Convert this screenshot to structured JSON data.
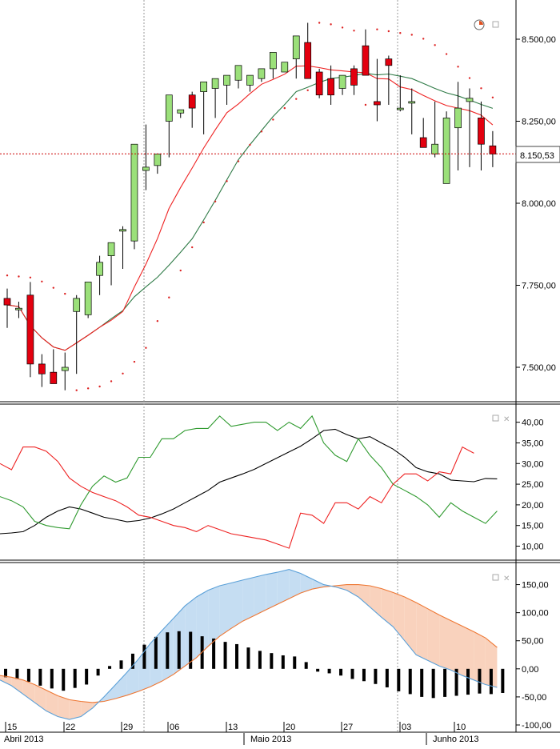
{
  "price_badge": "8.150,53",
  "axis_dates": {
    "ticks": [
      "15",
      "22",
      "29",
      "06",
      "13",
      "20",
      "27",
      "03",
      "10"
    ],
    "months": [
      "Abril 2013",
      "Maio 2013",
      "Junho 2013"
    ]
  },
  "panel_icons": {
    "clock": "clock-icon",
    "restore": "window-restore-icon",
    "close": "close-icon"
  },
  "colors": {
    "up": "#9be07a",
    "down": "#e3000f",
    "ma_fast": "#ee2222",
    "ma_slow": "#2e7a46",
    "psar": "#dd2222",
    "adx": "#000000",
    "di_plus": "#2f9a2f",
    "di_minus": "#ee2222",
    "macd": "#5aa0d8",
    "signal": "#ee7733"
  },
  "chart_data": [
    {
      "type": "candlestick",
      "title": "",
      "ylim": [
        7400,
        8600
      ],
      "yticks": [
        "7.500,00",
        "7.750,00",
        "8.000,00",
        "8.250,00",
        "8.500,00"
      ],
      "ytick_values": [
        7500,
        7750,
        8000,
        8250,
        8500
      ],
      "last_price": 8150.53,
      "x": [
        "Apr 15",
        "Apr 16",
        "Apr 17",
        "Apr 18",
        "Apr 19",
        "Apr 22",
        "Apr 23",
        "Apr 24",
        "Apr 25",
        "Apr 26",
        "Apr 29",
        "Apr 30",
        "May 02",
        "May 03",
        "May 06",
        "May 07",
        "May 08",
        "May 09",
        "May 10",
        "May 13",
        "May 14",
        "May 15",
        "May 16",
        "May 17",
        "May 20",
        "May 21",
        "May 22",
        "May 23",
        "May 24",
        "May 27",
        "May 28",
        "May 29",
        "May 30",
        "May 31",
        "Jun 03",
        "Jun 04",
        "Jun 05",
        "Jun 06",
        "Jun 07",
        "Jun 10",
        "Jun 11",
        "Jun 12",
        "Jun 13"
      ],
      "open": [
        7710,
        7680,
        7720,
        7510,
        7485,
        7490,
        7670,
        7660,
        7780,
        7840,
        7915,
        7885,
        8100,
        8115,
        8250,
        8275,
        8330,
        8340,
        8350,
        8360,
        8375,
        8360,
        8380,
        8410,
        8400,
        8440,
        8490,
        8400,
        8380,
        8350,
        8410,
        8480,
        8310,
        8440,
        8290,
        8310,
        8200,
        8150,
        8060,
        8230,
        8310,
        8260,
        8175
      ],
      "high": [
        7740,
        7700,
        7760,
        7540,
        7555,
        7545,
        7720,
        7690,
        7840,
        7850,
        7930,
        7940,
        8240,
        8135,
        8300,
        8280,
        8340,
        8340,
        8350,
        8370,
        8380,
        8380,
        8400,
        8430,
        8410,
        8450,
        8550,
        8410,
        8420,
        8370,
        8420,
        8530,
        8440,
        8450,
        8390,
        8350,
        8260,
        8310,
        8280,
        8370,
        8350,
        8310,
        8220
      ],
      "low": [
        7620,
        7650,
        7470,
        7440,
        7460,
        7430,
        7480,
        7650,
        7720,
        7750,
        7800,
        7860,
        8040,
        8090,
        8140,
        8260,
        8230,
        8210,
        8260,
        8300,
        8350,
        8340,
        8370,
        8380,
        8400,
        8380,
        8410,
        8320,
        8300,
        8330,
        8330,
        8400,
        8250,
        8300,
        8280,
        8210,
        8180,
        8140,
        8070,
        8100,
        8110,
        8100,
        8110
      ],
      "close": [
        7690,
        7680,
        7510,
        7480,
        7450,
        7500,
        7710,
        7760,
        7820,
        7880,
        7920,
        8180,
        8110,
        8150,
        8330,
        8285,
        8290,
        8370,
        8380,
        8390,
        8420,
        8390,
        8410,
        8460,
        8430,
        8510,
        8380,
        8330,
        8330,
        8390,
        8360,
        8390,
        8300,
        8420,
        8290,
        8310,
        8170,
        8180,
        8260,
        8290,
        8320,
        8180,
        8150
      ]
    },
    {
      "type": "line",
      "title": "",
      "ylim": [
        7,
        44
      ],
      "yticks": [
        "10,00",
        "15,00",
        "20,00",
        "25,00",
        "30,00",
        "35,00",
        "40,00"
      ],
      "ytick_values": [
        10,
        15,
        20,
        25,
        30,
        35,
        40
      ],
      "series_values": [
        [
          13.0,
          13.2,
          13.5,
          15.0,
          17.0,
          18.5,
          19.5,
          19.0,
          18.0,
          17.0,
          16.5,
          15.9,
          16.2,
          16.8,
          17.8,
          19.0,
          20.5,
          22.0,
          23.5,
          25.5,
          26.5,
          27.5,
          28.6,
          30.0,
          31.4,
          32.8,
          34.2,
          36.0,
          38.0,
          38.3,
          37.0,
          36.0,
          36.5,
          35.0,
          33.5,
          31.5,
          29.0,
          28.0,
          27.5,
          26.0,
          25.8,
          25.6,
          26.4,
          26.3
        ],
        [
          22.0,
          21.0,
          19.5,
          16.0,
          15.0,
          14.5,
          14.2,
          20.0,
          24.5,
          27.0,
          25.5,
          26.5,
          31.5,
          31.5,
          36.0,
          36.0,
          38.0,
          38.5,
          38.5,
          41.5,
          39.0,
          39.5,
          40.0,
          40.0,
          38.0,
          40.0,
          38.5,
          41.5,
          35.0,
          32.0,
          30.5,
          36.0,
          32.0,
          29.0,
          25.0,
          23.5,
          22.0,
          20.0,
          17.0,
          20.5,
          18.5,
          17.0,
          15.5,
          18.5
        ],
        [
          30.0,
          28.5,
          34.0,
          34.0,
          33.0,
          30.5,
          26.5,
          24.5,
          23.0,
          22.0,
          21.0,
          19.5,
          17.5,
          17.0,
          16.0,
          15.0,
          14.5,
          13.5,
          15.0,
          14.0,
          13.0,
          12.5,
          12.0,
          11.5,
          10.5,
          9.5,
          18.0,
          17.5,
          15.5,
          20.5,
          20.5,
          19.0,
          22.0,
          20.5,
          25.0,
          27.5,
          27.5,
          25.8,
          28.0,
          27.5,
          34.0,
          32.5
        ]
      ]
    },
    {
      "type": "line",
      "title": "",
      "ylim": [
        -110,
        185
      ],
      "yticks": [
        "-100,00",
        "-50,00",
        "0,00",
        "50,00",
        "100,00",
        "150,00"
      ],
      "ytick_values": [
        -100,
        -50,
        0,
        50,
        100,
        150
      ],
      "macd": [
        -20,
        -30,
        -45,
        -60,
        -75,
        -85,
        -90,
        -85,
        -70,
        -50,
        -28,
        -6,
        18,
        45,
        68,
        90,
        112,
        128,
        140,
        148,
        153,
        158,
        163,
        168,
        172,
        177,
        170,
        160,
        150,
        146,
        140,
        128,
        110,
        92,
        75,
        50,
        25,
        15,
        5,
        -2,
        -12,
        -20,
        -28,
        -33
      ],
      "signal": [
        -12,
        -15,
        -20,
        -28,
        -38,
        -48,
        -55,
        -58,
        -60,
        -58,
        -53,
        -47,
        -40,
        -32,
        -22,
        -10,
        5,
        20,
        40,
        58,
        72,
        85,
        95,
        105,
        115,
        125,
        135,
        142,
        146,
        148,
        150,
        150,
        148,
        143,
        136,
        128,
        118,
        107,
        96,
        86,
        76,
        66,
        55,
        38
      ],
      "histogram": [
        -15,
        -18,
        -23,
        -30,
        -35,
        -39,
        -34,
        -28,
        -12,
        5,
        15,
        27,
        43,
        57,
        65,
        67,
        66,
        58,
        54,
        48,
        44,
        38,
        32,
        28,
        24,
        22,
        12,
        -5,
        -8,
        -12,
        -18,
        -22,
        -27,
        -33,
        -40,
        -45,
        -50,
        -52,
        -50,
        -48,
        -46,
        -44,
        -45,
        -43
      ]
    }
  ]
}
